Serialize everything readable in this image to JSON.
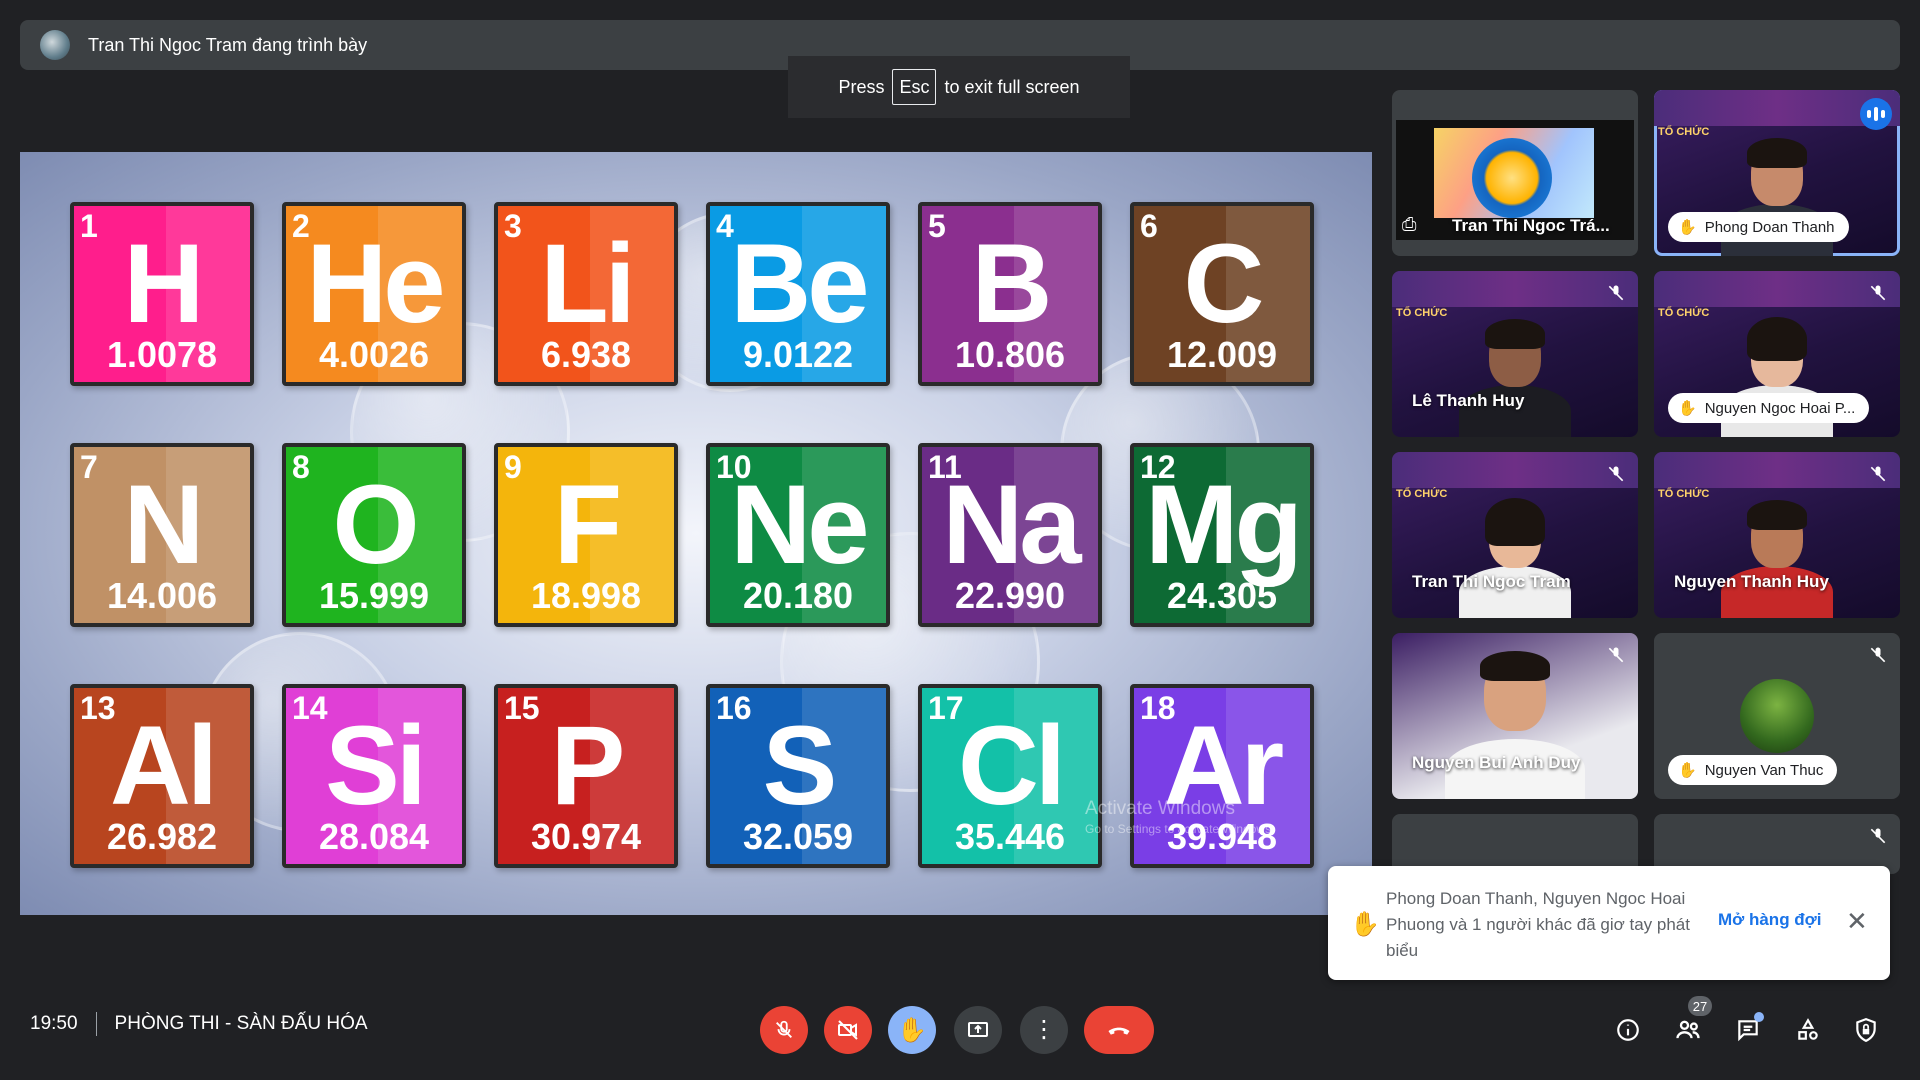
{
  "presenter_bar": {
    "text": "Tran Thi Ngoc Tram đang trình bày"
  },
  "esc_hint": {
    "prefix": "Press",
    "key": "Esc",
    "suffix": "to exit full screen"
  },
  "slide": {
    "watermark_title": "Activate Windows",
    "watermark_sub": "Go to Settings to activate Windows.",
    "elements": [
      {
        "num": "1",
        "sym": "H",
        "mass": "1.0078",
        "color": "#ff1e8c"
      },
      {
        "num": "2",
        "sym": "He",
        "mass": "4.0026",
        "color": "#f58a1f"
      },
      {
        "num": "3",
        "sym": "Li",
        "mass": "6.938",
        "color": "#f2541b"
      },
      {
        "num": "4",
        "sym": "Be",
        "mass": "9.0122",
        "color": "#0a9be4"
      },
      {
        "num": "5",
        "sym": "B",
        "mass": "10.806",
        "color": "#8b2f8f"
      },
      {
        "num": "6",
        "sym": "C",
        "mass": "12.009",
        "color": "#6e4224"
      },
      {
        "num": "7",
        "sym": "N",
        "mass": "14.006",
        "color": "#c09166"
      },
      {
        "num": "8",
        "sym": "O",
        "mass": "15.999",
        "color": "#1fb41f"
      },
      {
        "num": "9",
        "sym": "F",
        "mass": "18.998",
        "color": "#f4b50c"
      },
      {
        "num": "10",
        "sym": "Ne",
        "mass": "20.180",
        "color": "#0e8b44"
      },
      {
        "num": "11",
        "sym": "Na",
        "mass": "22.990",
        "color": "#6a2c86"
      },
      {
        "num": "12",
        "sym": "Mg",
        "mass": "24.305",
        "color": "#0d6a34"
      },
      {
        "num": "13",
        "sym": "Al",
        "mass": "26.982",
        "color": "#b8451f"
      },
      {
        "num": "14",
        "sym": "Si",
        "mass": "28.084",
        "color": "#e03fd6"
      },
      {
        "num": "15",
        "sym": "P",
        "mass": "30.974",
        "color": "#c7201f"
      },
      {
        "num": "16",
        "sym": "S",
        "mass": "32.059",
        "color": "#1261b8"
      },
      {
        "num": "17",
        "sym": "Cl",
        "mass": "35.446",
        "color": "#13c1a8"
      },
      {
        "num": "18",
        "sym": "Ar",
        "mass": "39.948",
        "color": "#7a3ee6"
      }
    ]
  },
  "participants": {
    "presenting_tile_name": "Tran Thi Ngoc Trá...",
    "phong": "Phong Doan Thanh",
    "le_huy": "Lê Thanh Huy",
    "hoai": "Nguyen Ngoc Hoai P...",
    "tram": "Tran Thi Ngoc Tram",
    "thanh_huy": "Nguyen Thanh Huy",
    "duy": "Nguyen Bui Anh Duy",
    "thuc": "Nguyen Van Thuc",
    "banner_tag": "TỔ CHỨC"
  },
  "toast": {
    "message": "Phong Doan Thanh, Nguyen Ngoc Hoai Phuong và 1 người khác đã giơ tay phát biểu",
    "action": "Mở hàng đợi"
  },
  "meeting": {
    "time": "19:50",
    "title": "PHÒNG THI - SÀN ĐẤU HÓA",
    "participant_count": "27"
  }
}
